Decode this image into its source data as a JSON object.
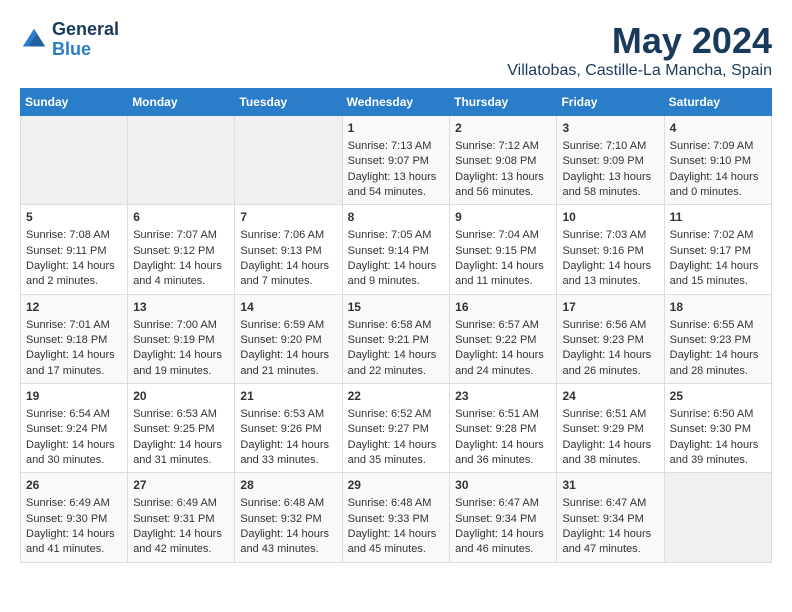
{
  "header": {
    "logo_line1": "General",
    "logo_line2": "Blue",
    "title": "May 2024",
    "subtitle": "Villatobas, Castille-La Mancha, Spain"
  },
  "weekdays": [
    "Sunday",
    "Monday",
    "Tuesday",
    "Wednesday",
    "Thursday",
    "Friday",
    "Saturday"
  ],
  "weeks": [
    [
      {
        "day": "",
        "info": ""
      },
      {
        "day": "",
        "info": ""
      },
      {
        "day": "",
        "info": ""
      },
      {
        "day": "1",
        "info": "Sunrise: 7:13 AM\nSunset: 9:07 PM\nDaylight: 13 hours\nand 54 minutes."
      },
      {
        "day": "2",
        "info": "Sunrise: 7:12 AM\nSunset: 9:08 PM\nDaylight: 13 hours\nand 56 minutes."
      },
      {
        "day": "3",
        "info": "Sunrise: 7:10 AM\nSunset: 9:09 PM\nDaylight: 13 hours\nand 58 minutes."
      },
      {
        "day": "4",
        "info": "Sunrise: 7:09 AM\nSunset: 9:10 PM\nDaylight: 14 hours\nand 0 minutes."
      }
    ],
    [
      {
        "day": "5",
        "info": "Sunrise: 7:08 AM\nSunset: 9:11 PM\nDaylight: 14 hours\nand 2 minutes."
      },
      {
        "day": "6",
        "info": "Sunrise: 7:07 AM\nSunset: 9:12 PM\nDaylight: 14 hours\nand 4 minutes."
      },
      {
        "day": "7",
        "info": "Sunrise: 7:06 AM\nSunset: 9:13 PM\nDaylight: 14 hours\nand 7 minutes."
      },
      {
        "day": "8",
        "info": "Sunrise: 7:05 AM\nSunset: 9:14 PM\nDaylight: 14 hours\nand 9 minutes."
      },
      {
        "day": "9",
        "info": "Sunrise: 7:04 AM\nSunset: 9:15 PM\nDaylight: 14 hours\nand 11 minutes."
      },
      {
        "day": "10",
        "info": "Sunrise: 7:03 AM\nSunset: 9:16 PM\nDaylight: 14 hours\nand 13 minutes."
      },
      {
        "day": "11",
        "info": "Sunrise: 7:02 AM\nSunset: 9:17 PM\nDaylight: 14 hours\nand 15 minutes."
      }
    ],
    [
      {
        "day": "12",
        "info": "Sunrise: 7:01 AM\nSunset: 9:18 PM\nDaylight: 14 hours\nand 17 minutes."
      },
      {
        "day": "13",
        "info": "Sunrise: 7:00 AM\nSunset: 9:19 PM\nDaylight: 14 hours\nand 19 minutes."
      },
      {
        "day": "14",
        "info": "Sunrise: 6:59 AM\nSunset: 9:20 PM\nDaylight: 14 hours\nand 21 minutes."
      },
      {
        "day": "15",
        "info": "Sunrise: 6:58 AM\nSunset: 9:21 PM\nDaylight: 14 hours\nand 22 minutes."
      },
      {
        "day": "16",
        "info": "Sunrise: 6:57 AM\nSunset: 9:22 PM\nDaylight: 14 hours\nand 24 minutes."
      },
      {
        "day": "17",
        "info": "Sunrise: 6:56 AM\nSunset: 9:23 PM\nDaylight: 14 hours\nand 26 minutes."
      },
      {
        "day": "18",
        "info": "Sunrise: 6:55 AM\nSunset: 9:23 PM\nDaylight: 14 hours\nand 28 minutes."
      }
    ],
    [
      {
        "day": "19",
        "info": "Sunrise: 6:54 AM\nSunset: 9:24 PM\nDaylight: 14 hours\nand 30 minutes."
      },
      {
        "day": "20",
        "info": "Sunrise: 6:53 AM\nSunset: 9:25 PM\nDaylight: 14 hours\nand 31 minutes."
      },
      {
        "day": "21",
        "info": "Sunrise: 6:53 AM\nSunset: 9:26 PM\nDaylight: 14 hours\nand 33 minutes."
      },
      {
        "day": "22",
        "info": "Sunrise: 6:52 AM\nSunset: 9:27 PM\nDaylight: 14 hours\nand 35 minutes."
      },
      {
        "day": "23",
        "info": "Sunrise: 6:51 AM\nSunset: 9:28 PM\nDaylight: 14 hours\nand 36 minutes."
      },
      {
        "day": "24",
        "info": "Sunrise: 6:51 AM\nSunset: 9:29 PM\nDaylight: 14 hours\nand 38 minutes."
      },
      {
        "day": "25",
        "info": "Sunrise: 6:50 AM\nSunset: 9:30 PM\nDaylight: 14 hours\nand 39 minutes."
      }
    ],
    [
      {
        "day": "26",
        "info": "Sunrise: 6:49 AM\nSunset: 9:30 PM\nDaylight: 14 hours\nand 41 minutes."
      },
      {
        "day": "27",
        "info": "Sunrise: 6:49 AM\nSunset: 9:31 PM\nDaylight: 14 hours\nand 42 minutes."
      },
      {
        "day": "28",
        "info": "Sunrise: 6:48 AM\nSunset: 9:32 PM\nDaylight: 14 hours\nand 43 minutes."
      },
      {
        "day": "29",
        "info": "Sunrise: 6:48 AM\nSunset: 9:33 PM\nDaylight: 14 hours\nand 45 minutes."
      },
      {
        "day": "30",
        "info": "Sunrise: 6:47 AM\nSunset: 9:34 PM\nDaylight: 14 hours\nand 46 minutes."
      },
      {
        "day": "31",
        "info": "Sunrise: 6:47 AM\nSunset: 9:34 PM\nDaylight: 14 hours\nand 47 minutes."
      },
      {
        "day": "",
        "info": ""
      }
    ]
  ]
}
